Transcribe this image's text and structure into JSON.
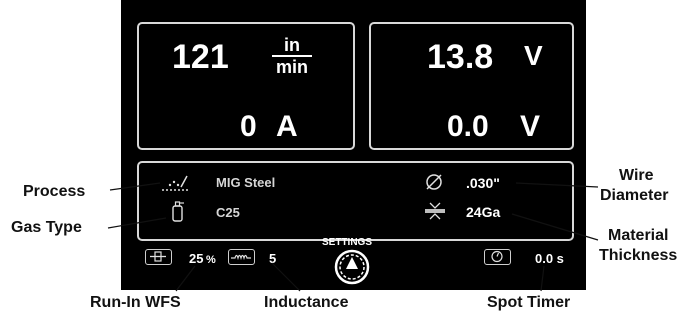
{
  "display": {
    "wfs": {
      "value": "121",
      "unit_top": "in",
      "unit_bottom": "min"
    },
    "voltage_set": {
      "value": "13.8",
      "unit": "V"
    },
    "amps": {
      "value": "0",
      "unit": "A"
    },
    "voltage_actual": {
      "value": "0.0",
      "unit": "V"
    }
  },
  "info": {
    "process": "MIG Steel",
    "gas": "C25",
    "wire_diameter": ".030\"",
    "material": "24Ga"
  },
  "bottom_bar": {
    "run_in_wfs": "25",
    "run_in_unit": "%",
    "inductance": "5",
    "settings_label": "SETTINGS",
    "spot_timer": "0.0 s"
  },
  "callouts": {
    "process": "Process",
    "gas_type": "Gas Type",
    "wire_diameter_1": "Wire",
    "wire_diameter_2": "Diameter",
    "material_1": "Material",
    "material_2": "Thickness",
    "run_in_wfs": "Run-In WFS",
    "inductance": "Inductance",
    "spot_timer": "Spot Timer"
  },
  "icons": {
    "process": "weld-process-icon",
    "gas": "gas-cylinder-icon",
    "wire": "diameter-icon",
    "material": "material-thickness-icon",
    "run_in": "run-in-icon",
    "inductance": "inductance-coil-icon",
    "settings": "settings-knob-icon",
    "spot": "timer-icon"
  }
}
